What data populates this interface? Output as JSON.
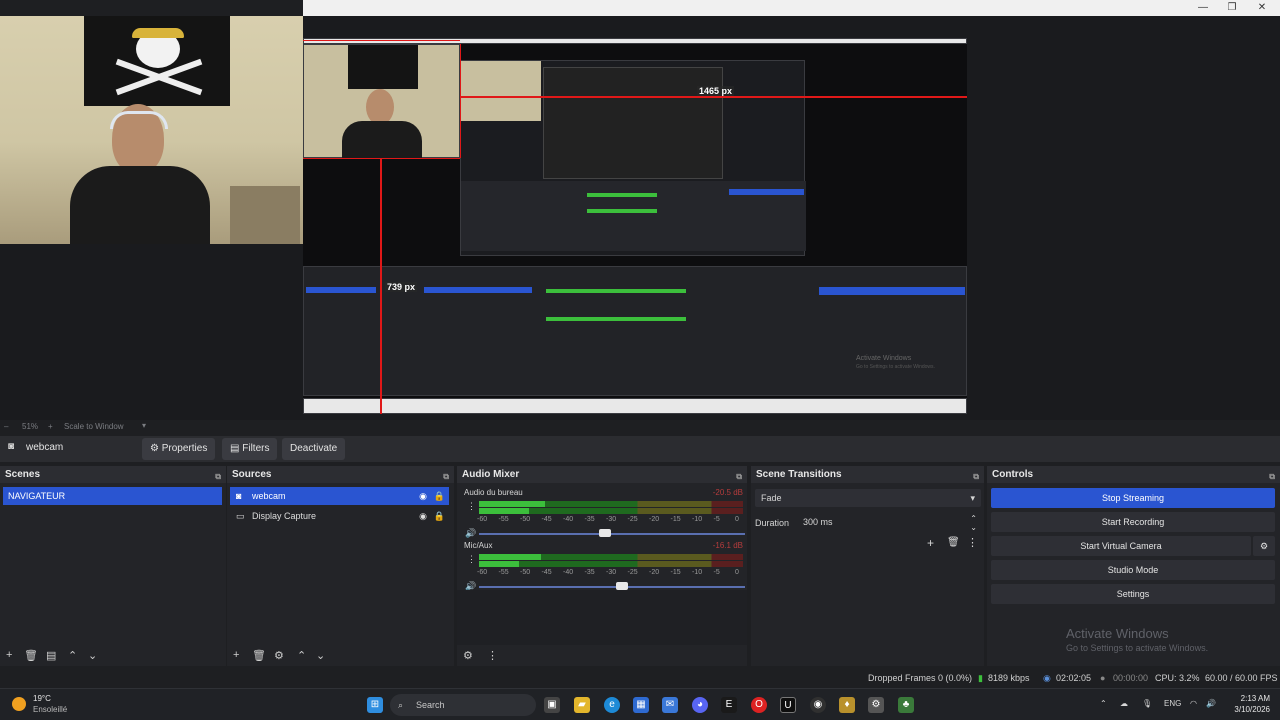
{
  "window": {
    "minimize_icon": "—",
    "maximize_icon": "❐",
    "close_icon": "✕"
  },
  "preview": {
    "measure_width": "1465 px",
    "measure_height": "739 px",
    "nested_activate_title": "Activate Windows",
    "nested_activate_sub": "Go to Settings to activate Windows."
  },
  "zoom_bar": {
    "zoom": "51%",
    "scale_mode": "Scale to Window"
  },
  "source_toolbar": {
    "source_name": "webcam",
    "properties": "Properties",
    "filters": "Filters",
    "deactivate": "Deactivate"
  },
  "scenes": {
    "title": "Scenes",
    "items": [
      "NAVIGATEUR"
    ]
  },
  "sources": {
    "title": "Sources",
    "items": [
      {
        "label": "webcam",
        "selected": true
      },
      {
        "label": "Display Capture",
        "selected": false
      }
    ]
  },
  "audio_mixer": {
    "title": "Audio Mixer",
    "channels": [
      {
        "name": "Audio du bureau",
        "db": "-20.5 dB"
      },
      {
        "name": "Mic/Aux",
        "db": "-16.1 dB"
      }
    ],
    "ticks": [
      "-60",
      "-55",
      "-50",
      "-45",
      "-40",
      "-35",
      "-30",
      "-25",
      "-20",
      "-15",
      "-10",
      "-5",
      "0"
    ]
  },
  "scene_transitions": {
    "title": "Scene Transitions",
    "transition": "Fade",
    "duration_label": "Duration",
    "duration_value": "300 ms"
  },
  "controls": {
    "title": "Controls",
    "buttons": [
      "Stop Streaming",
      "Start Recording",
      "Start Virtual Camera",
      "Studio Mode",
      "Settings"
    ]
  },
  "activation": {
    "title": "Activate Windows",
    "subtitle": "Go to Settings to activate Windows."
  },
  "status": {
    "dropped": "Dropped Frames 0 (0.0%)",
    "bitrate": "8189 kbps",
    "stream_time": "02:02:05",
    "rec_time": "00:00:00",
    "cpu": "CPU: 3.2%",
    "fps": "60.00 / 60.00 FPS"
  },
  "taskbar": {
    "weather_temp": "19°C",
    "weather_desc": "Ensoleillé",
    "search_placeholder": "Search",
    "language": "ENG",
    "time": "2:13 AM",
    "date": "3/10/2026"
  },
  "colors": {
    "accent": "#2a55d1",
    "meter_green": "#3cbf3c",
    "meter_yellow": "#b9b53c",
    "meter_red": "#b53c3c",
    "measure_red": "#e01818"
  }
}
